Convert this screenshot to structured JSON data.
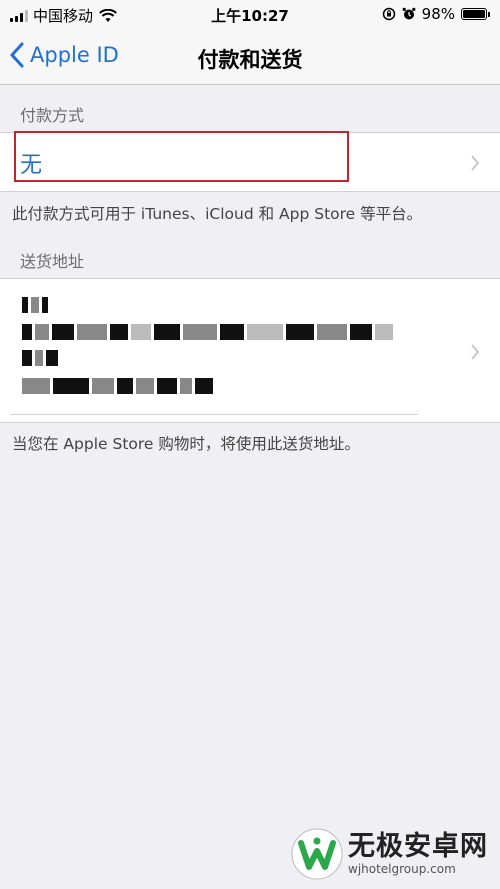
{
  "status_bar": {
    "carrier": "中国移动",
    "time": "上午10:27",
    "battery": "98%",
    "battery_level": 0.98
  },
  "nav": {
    "back_label": "Apple ID",
    "title": "付款和送货"
  },
  "payment_section": {
    "header": "付款方式",
    "value": "无",
    "footer": "此付款方式可用于 iTunes、iCloud 和 App Store 等平台。"
  },
  "shipping_section": {
    "header": "送货地址",
    "footer": "当您在 Apple Store 购物时，将使用此送货地址。"
  },
  "colors": {
    "accent": "#1f6fd6",
    "highlight": "#c0262e",
    "background": "#efeff4"
  },
  "watermark": {
    "title": "无极安卓网",
    "url": "wjhotelgroup.com"
  }
}
